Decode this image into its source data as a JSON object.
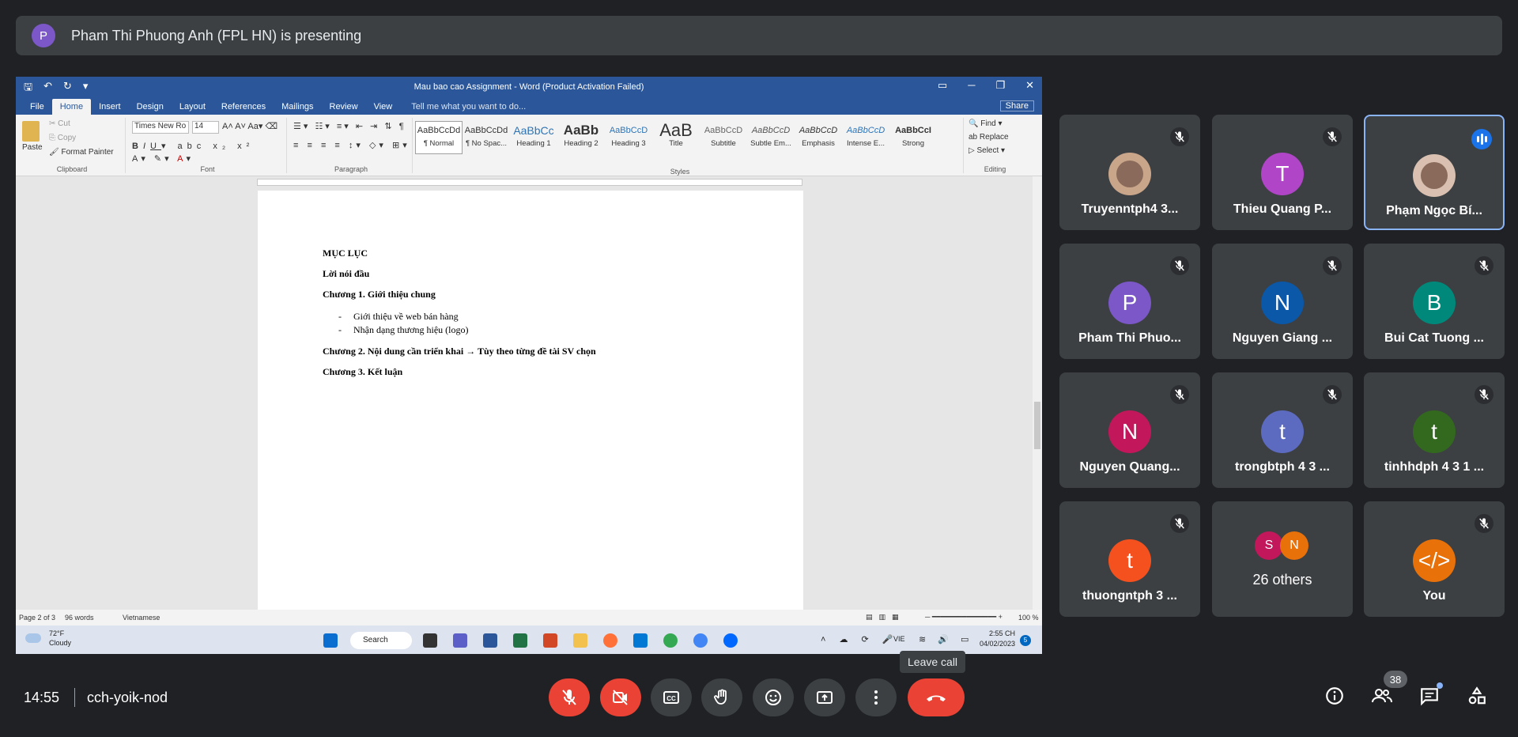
{
  "banner": {
    "avatar_letter": "P",
    "text": "Pham Thi Phuong Anh (FPL HN) is presenting"
  },
  "word": {
    "title": "Mau bao cao Assignment - Word (Product Activation Failed)",
    "window_buttons": [
      "▭",
      "─",
      "Restore",
      "✕"
    ],
    "tabs": [
      "File",
      "Home",
      "Insert",
      "Design",
      "Layout",
      "References",
      "Mailings",
      "Review",
      "View"
    ],
    "active_tab": "Home",
    "tell_me": "Tell me what you want to do...",
    "share": "Share",
    "clipboard": {
      "paste": "Paste",
      "cut": "Cut",
      "copy": "Copy",
      "format_painter": "Format Painter",
      "label": "Clipboard"
    },
    "font": {
      "name": "Times New Ro",
      "size": "14",
      "label": "Font"
    },
    "paragraph_label": "Paragraph",
    "styles": [
      {
        "preview": "AaBbCcDd",
        "name": "¶ Normal"
      },
      {
        "preview": "AaBbCcDd",
        "name": "¶ No Spac..."
      },
      {
        "preview": "AaBbCc",
        "name": "Heading 1"
      },
      {
        "preview": "AaBb",
        "name": "Heading 2"
      },
      {
        "preview": "AaBbCcD",
        "name": "Heading 3"
      },
      {
        "preview": "AaB",
        "name": "Title"
      },
      {
        "preview": "AaBbCcD",
        "name": "Subtitle"
      },
      {
        "preview": "AaBbCcD",
        "name": "Subtle Em..."
      },
      {
        "preview": "AaBbCcD",
        "name": "Emphasis"
      },
      {
        "preview": "AaBbCcD",
        "name": "Intense E..."
      },
      {
        "preview": "AaBbCcI",
        "name": "Strong"
      }
    ],
    "styles_label": "Styles",
    "editing": {
      "find": "Find",
      "replace": "Replace",
      "select": "Select",
      "label": "Editing"
    },
    "document": {
      "toc": "MỤC LỤC",
      "preface": "Lời nói đầu",
      "ch1": "Chương 1. Giới thiệu chung",
      "ch1_items": [
        "Giới thiệu về web bán hàng",
        "Nhận dạng thương hiệu (logo)"
      ],
      "ch2": "Chương 2. Nội dung cần triển khai → Tùy theo từng đề tài SV chọn",
      "ch3": "Chương 3. Kết luận"
    },
    "statusbar": {
      "page": "Page 2 of 3",
      "words": "96 words",
      "lang": "Vietnamese",
      "zoom": "100 %"
    }
  },
  "taskbar": {
    "weather_temp": "72°F",
    "weather_desc": "Cloudy",
    "search": "Search",
    "lang": "VIE",
    "time": "2:55 CH",
    "date": "04/02/2023",
    "notif": "5"
  },
  "tiles": [
    {
      "name": "Truyenntph4 3...",
      "letter": "",
      "color": "#c9a58a",
      "photo": true,
      "muted": true
    },
    {
      "name": "Thieu Quang P...",
      "letter": "T",
      "color": "#b045c7",
      "muted": true
    },
    {
      "name": "Phạm Ngọc Bí...",
      "letter": "",
      "color": "#d9c0b0",
      "photo": true,
      "speaking": true
    },
    {
      "name": "Pham Thi Phuo...",
      "letter": "P",
      "color": "#7b57c7",
      "muted": true
    },
    {
      "name": "Nguyen Giang ...",
      "letter": "N",
      "color": "#0b57a8",
      "muted": true
    },
    {
      "name": "Bui Cat Tuong ...",
      "letter": "B",
      "color": "#00897b",
      "muted": true
    },
    {
      "name": "Nguyen Quang...",
      "letter": "N",
      "color": "#c2185b",
      "muted": true
    },
    {
      "name": "trongbtph 4 3 ...",
      "letter": "t",
      "color": "#5c6bc0",
      "muted": true
    },
    {
      "name": "tinhhdph 4 3 1 ...",
      "letter": "t",
      "color": "#33691e",
      "muted": true
    },
    {
      "name": "thuongntph 3 ...",
      "letter": "t",
      "color": "#f4511e",
      "muted": true
    },
    {
      "name": "26 others",
      "others": [
        "S",
        "N"
      ]
    },
    {
      "name": "You",
      "letter": "</>",
      "color": "#e8710a",
      "muted": true
    }
  ],
  "footer": {
    "time": "14:55",
    "meeting_code": "cch-yoik-nod",
    "leave_tooltip": "Leave call",
    "participants_count": "38"
  }
}
